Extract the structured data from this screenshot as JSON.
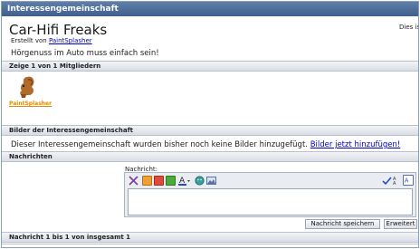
{
  "header": {
    "title": "Interessengemeinschaft"
  },
  "group": {
    "name": "Car-Hifi Freaks",
    "created_prefix": "Erstellt von",
    "created_by": "PaintSplasher",
    "side_text": "Dies ist",
    "description": "Hörgenuss im Auto muss einfach sein!"
  },
  "members_section": {
    "heading": "Zeige 1 von 1 Mitgliedern",
    "members": [
      {
        "name": "PaintSplasher",
        "avatar_icon": "squirrel-avatar-icon"
      }
    ]
  },
  "pictures_section": {
    "heading": "Bilder der Interessengemeinschaft",
    "text": "Dieser Interessengemeinschaft wurden bisher noch keine Bilder hinzugefügt.",
    "link": "Bilder jetzt hinzufügen!"
  },
  "messages_section": {
    "heading": "Nachrichten",
    "message_label": "Nachricht:",
    "toolbar_icons": [
      "special-chars-icon",
      "orange-bullet-icon",
      "red-bullet-icon",
      "green-bullet-icon",
      "font-color-icon",
      "smiley-icon",
      "image-icon",
      "spellcheck-icon",
      "font-size-icon",
      "html-mode-icon"
    ],
    "save_button": "Nachricht speichern",
    "advanced_button": "Erweitert",
    "footer": "Nachricht 1 bis 1 von insgesamt 1"
  },
  "colors": {
    "header_bg": "#4a6a97",
    "link": "#0000cc",
    "member_link": "#e08a00"
  }
}
